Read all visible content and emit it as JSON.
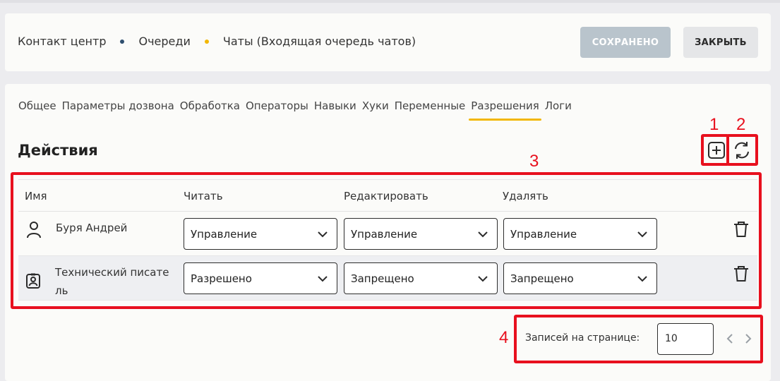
{
  "breadcrumb": {
    "items": [
      "Контакт центр",
      "Очереди",
      "Чаты (Входящая очередь чатов)"
    ],
    "dot_colors": [
      "#2f4f6f",
      "#f2b705"
    ]
  },
  "header": {
    "saved_label": "СОХРАНЕНО",
    "close_label": "ЗАКРЫТЬ"
  },
  "tabs": [
    "Общее",
    "Параметры дозвона",
    "Обработка",
    "Операторы",
    "Навыки",
    "Хуки",
    "Переменные",
    "Разрешения",
    "Логи"
  ],
  "active_tab": "Разрешения",
  "section": {
    "title": "Действия",
    "add_icon": "add-square-icon",
    "refresh_icon": "refresh-icon"
  },
  "table": {
    "columns": [
      "Имя",
      "Читать",
      "Редактировать",
      "Удалять"
    ],
    "rows": [
      {
        "name": "Буря Андрей",
        "icon": "user-icon",
        "read": "Управление",
        "edit": "Управление",
        "delete": "Управление"
      },
      {
        "name_line1": "Технический писате",
        "name_line2": "ль",
        "icon": "role-badge-icon",
        "read": "Разрешено",
        "edit": "Запрещено",
        "delete": "Запрещено"
      }
    ]
  },
  "pagination": {
    "label": "Записей на странице:",
    "page_size": "10"
  },
  "annotations": [
    "1",
    "2",
    "3",
    "4"
  ],
  "colors": {
    "accent": "#f2b705",
    "annotation": "#e8101e",
    "saved_button": "#b9c4cc"
  }
}
